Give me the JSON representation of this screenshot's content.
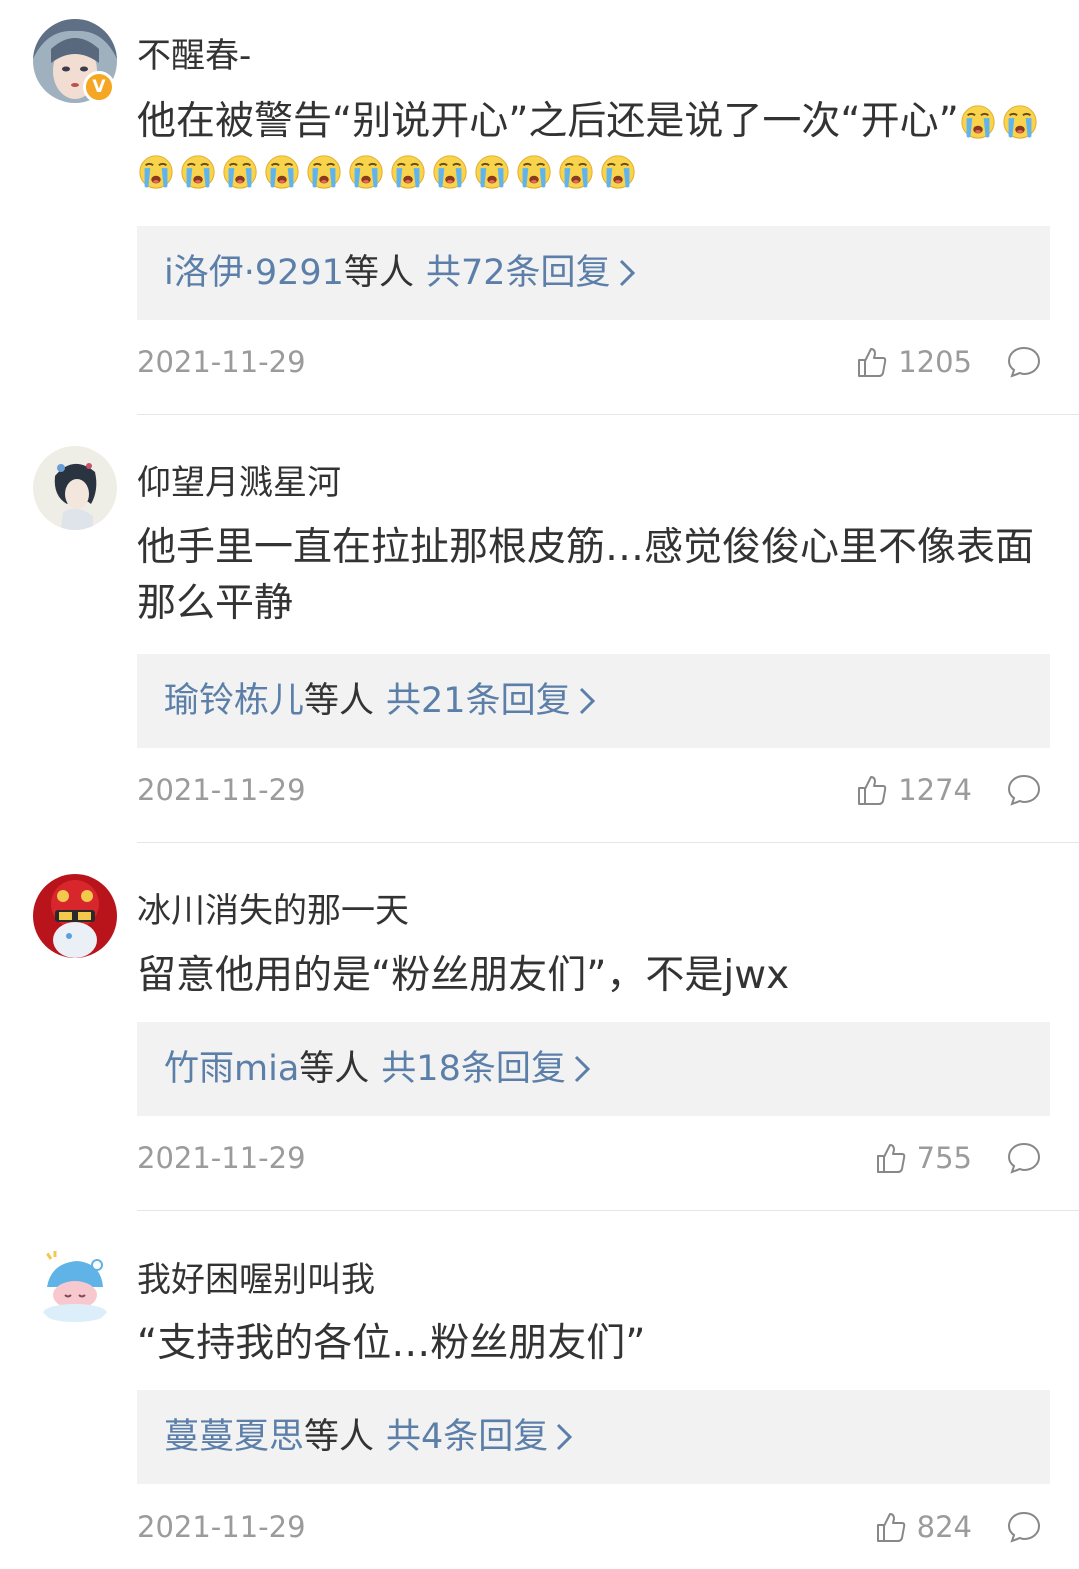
{
  "comments": [
    {
      "username": "不醒春-",
      "content": "他在被警告“别说开心”之后还是说了一次“开心”",
      "reply_names": "i洛伊·9291",
      "reply_etc": "等人",
      "reply_total": "共72条回复",
      "date": "2021-11-29",
      "likes": "1205"
    },
    {
      "username": "仰望月溅星河",
      "content": "他手里一直在拉扯那根皮筋…感觉俊俊心里不像表面那么平静",
      "reply_names": "瑜铃栋儿",
      "reply_etc": "等人",
      "reply_total": "共21条回复",
      "date": "2021-11-29",
      "likes": "1274"
    },
    {
      "username": "冰川消失的那一天",
      "content": "留意他用的是“粉丝朋友们”，不是jwx",
      "reply_names": "竹雨mia",
      "reply_etc": "等人",
      "reply_total": "共18条回复",
      "date": "2021-11-29",
      "likes": "755"
    },
    {
      "username": "我好困喔别叫我",
      "content": "“支持我的各位…粉丝朋友们”",
      "reply_names": "蔓蔓夏思",
      "reply_etc": "等人",
      "reply_total": "共4条回复",
      "date": "2021-11-29",
      "likes": "824"
    }
  ],
  "badge": {
    "verified_label": "V",
    "color": "#f5a623"
  },
  "emoji": {
    "name": "crying-face-emoji",
    "inline_count": 2,
    "row_count": 12
  },
  "icons": {
    "like": "thumbs-up-icon",
    "reply": "speech-bubble-icon",
    "chevron": "chevron-right-icon"
  },
  "colors": {
    "link": "#5b7fa8",
    "meta": "#9b9b9b",
    "reply_bg": "#f2f2f2"
  }
}
